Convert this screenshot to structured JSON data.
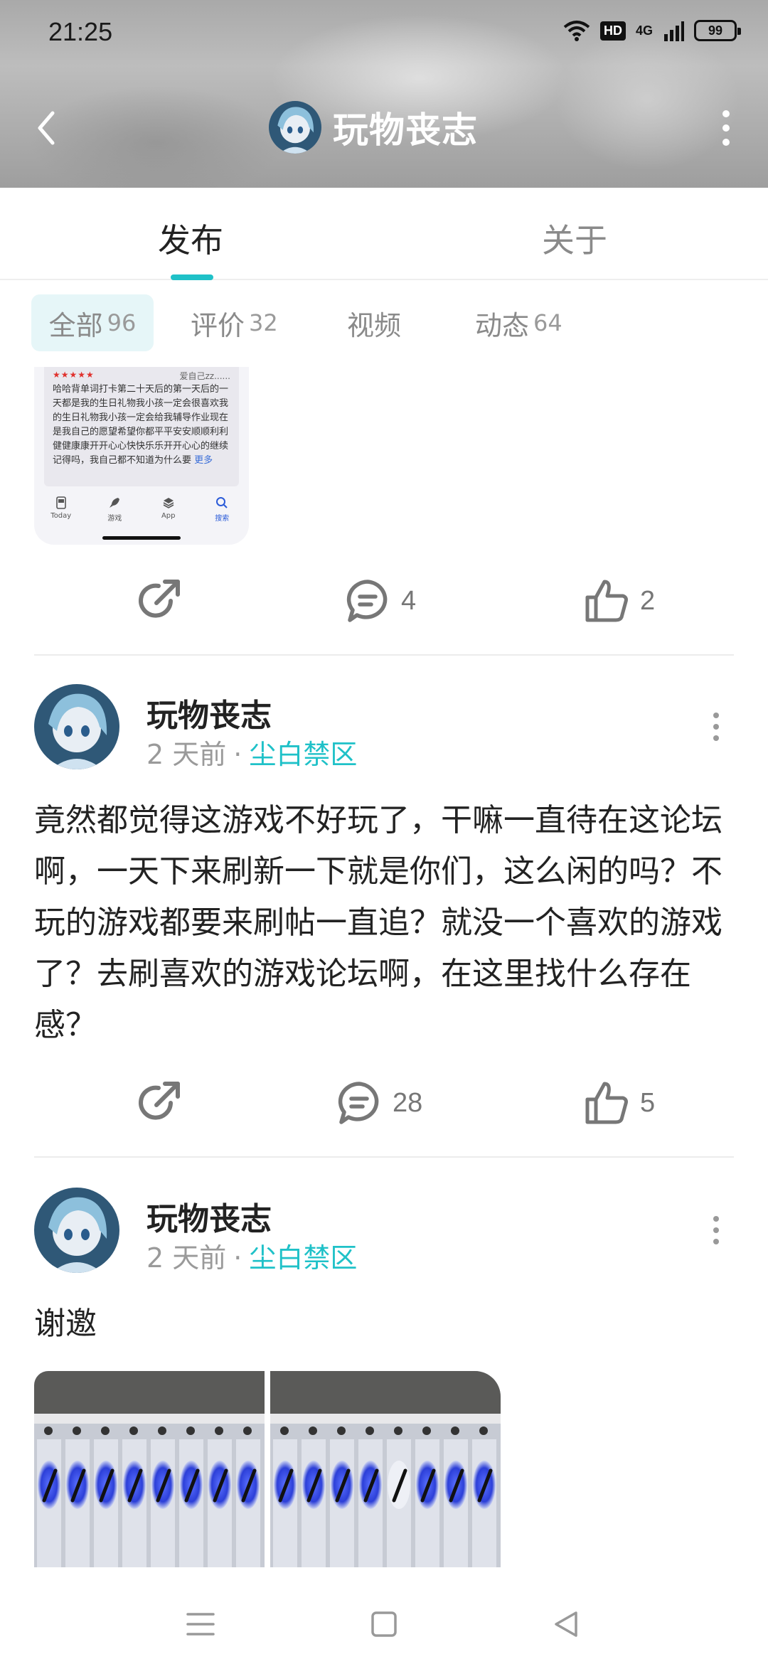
{
  "status_bar": {
    "time": "21:25",
    "hd": "HD",
    "network": "4G",
    "battery": "99"
  },
  "header": {
    "title": "玩物丧志"
  },
  "tabs": [
    {
      "label": "发布",
      "active": true
    },
    {
      "label": "关于",
      "active": false
    }
  ],
  "filters": [
    {
      "label": "全部",
      "count": "96",
      "active": true
    },
    {
      "label": "评价",
      "count": "32"
    },
    {
      "label": "视频",
      "count": ""
    },
    {
      "label": "动态",
      "count": "64"
    }
  ],
  "embedded_screenshot": {
    "stars": "★★★★★",
    "username": "爱自己zz......",
    "review_text": "哈哈背单词打卡第二十天后的第一天后的一天都是我的生日礼物我小孩一定会很喜欢我的生日礼物我小孩一定会给我辅导作业现在是我自己的愿望希望你都平平安安顺顺利利健健康康开开心心快快乐乐开开心心的继续记得吗，我自己都不知道为什么要",
    "more": "更多",
    "nav": [
      {
        "label": "Today",
        "icon": "today-icon"
      },
      {
        "label": "游戏",
        "icon": "rocket-icon"
      },
      {
        "label": "App",
        "icon": "app-stack-icon"
      },
      {
        "label": "搜索",
        "icon": "search-icon",
        "active": true
      }
    ]
  },
  "post_0_actions": {
    "comments": "4",
    "likes": "2"
  },
  "posts": [
    {
      "author": "玩物丧志",
      "time": "2 天前",
      "separator": "·",
      "forum": "尘白禁区",
      "body": "竟然都觉得这游戏不好玩了，干嘛一直待在这论坛啊，一天下来刷新一下就是你们，这么闲的吗？不玩的游戏都要来刷帖一直追？就没一个喜欢的游戏了？去刷喜欢的游戏论坛啊，在这里找什么存在感？",
      "comments": "28",
      "likes": "5"
    },
    {
      "author": "玩物丧志",
      "time": "2 天前",
      "separator": "·",
      "forum": "尘白禁区",
      "body": "谢邀"
    }
  ],
  "colors": {
    "accent": "#1fc1c8",
    "text": "#222222",
    "muted": "#8a8a8a",
    "icon": "#777777"
  }
}
